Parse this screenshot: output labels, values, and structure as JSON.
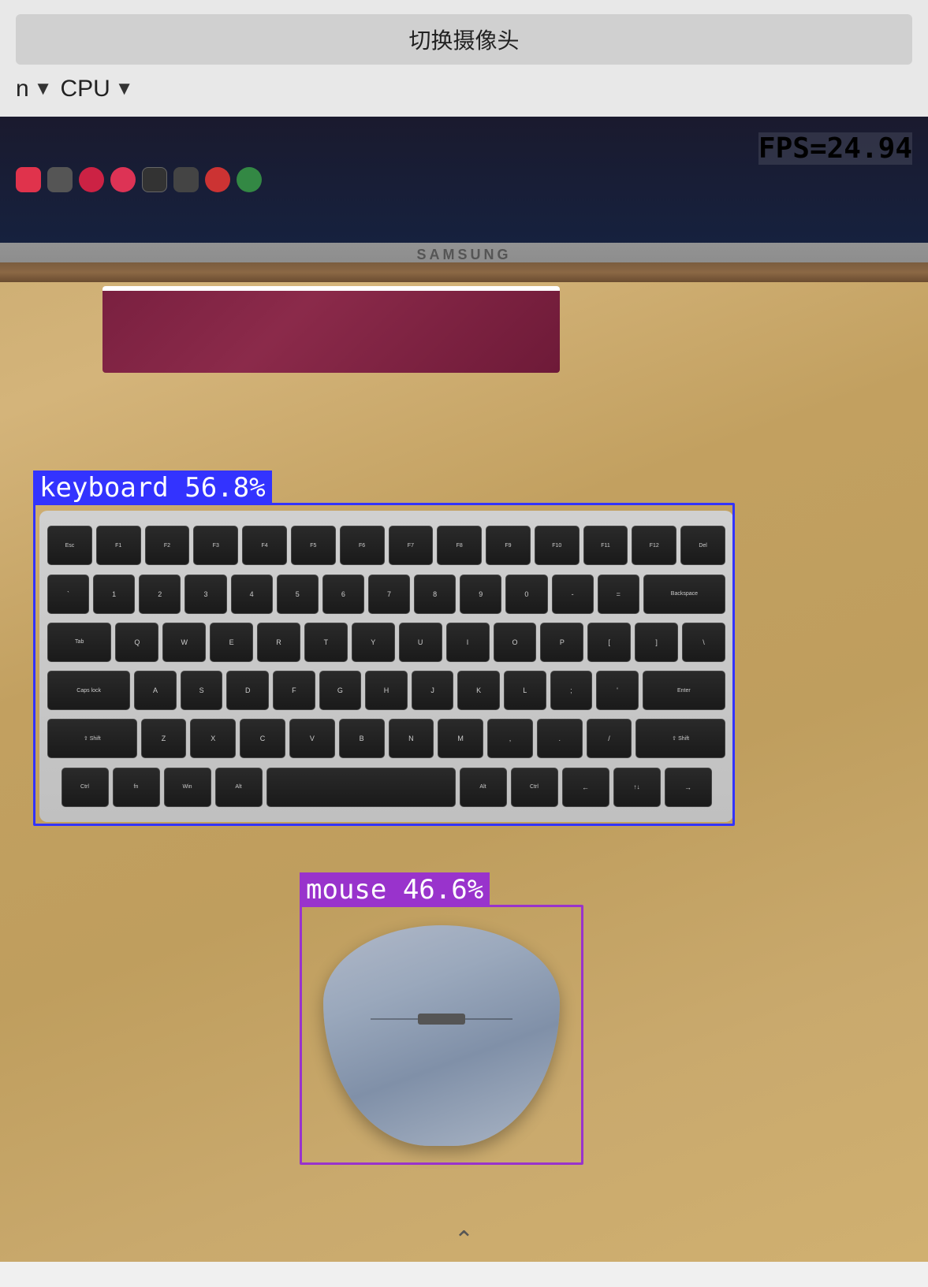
{
  "topBar": {
    "switchCameraLabel": "切换摄像头",
    "modelDropdown": {
      "value": "n",
      "arrowSymbol": "▼"
    },
    "backendDropdown": {
      "value": "CPU",
      "arrowSymbol": "▼"
    }
  },
  "overlay": {
    "fps": "FPS=24.94",
    "detections": [
      {
        "id": "keyboard",
        "label": "keyboard 56.8%",
        "color": "#3333ff"
      },
      {
        "id": "mouse",
        "label": "mouse 46.6%",
        "color": "#9933cc"
      }
    ]
  },
  "monitor": {
    "brand": "SAMSUNG"
  },
  "icons": {
    "chevronDown": "⌄"
  }
}
